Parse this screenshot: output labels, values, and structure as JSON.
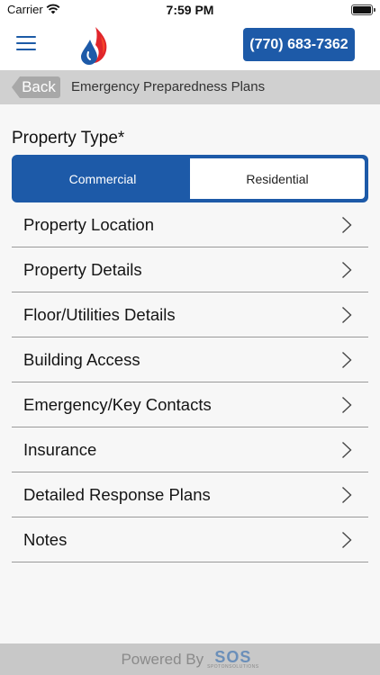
{
  "status_bar": {
    "carrier": "Carrier",
    "time": "7:59 PM",
    "wifi_icon": "wifi-icon",
    "battery_icon": "battery-icon"
  },
  "header": {
    "menu_icon": "hamburger-menu-icon",
    "logo_icon": "fire-water-drop-logo",
    "phone": "(770) 683-7362",
    "accent_color": "#1d5aa8"
  },
  "navbar": {
    "back_label": "Back",
    "title": "Emergency Preparedness Plans"
  },
  "property_type": {
    "label": "Property Type*",
    "options": [
      "Commercial",
      "Residential"
    ],
    "selected": "Commercial"
  },
  "sections": [
    {
      "label": "Property Location"
    },
    {
      "label": "Property Details"
    },
    {
      "label": "Floor/Utilities Details"
    },
    {
      "label": "Building Access"
    },
    {
      "label": "Emergency/Key Contacts"
    },
    {
      "label": "Insurance"
    },
    {
      "label": "Detailed Response Plans"
    },
    {
      "label": "Notes"
    }
  ],
  "footer": {
    "powered_by": "Powered By",
    "brand": "SOS",
    "brand_sub": "SPOTONSOLUTIONS"
  }
}
